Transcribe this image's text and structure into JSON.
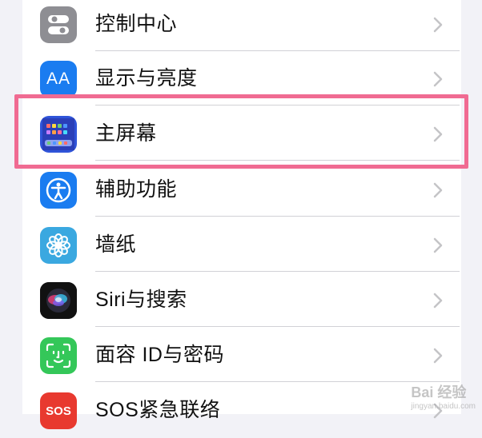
{
  "settings": {
    "items": [
      {
        "label": "控制中心",
        "icon": "control-center-icon",
        "color": "#8e8e93"
      },
      {
        "label": "显示与亮度",
        "icon": "display-brightness-icon",
        "color": "#1a7cf0",
        "icon_text": "AA"
      },
      {
        "label": "主屏幕",
        "icon": "home-screen-icon",
        "color": "#2f54d9"
      },
      {
        "label": "辅助功能",
        "icon": "accessibility-icon",
        "color": "#1a7cf0"
      },
      {
        "label": "墙纸",
        "icon": "wallpaper-icon",
        "color": "#3aa8e0"
      },
      {
        "label": "Siri与搜索",
        "icon": "siri-icon",
        "color": "#1c1c1e"
      },
      {
        "label": "面容 ID与密码",
        "icon": "face-id-icon",
        "color": "#34c759"
      },
      {
        "label": "SOS紧急联络",
        "icon": "sos-icon",
        "color": "#e8392f",
        "icon_text": "SOS"
      }
    ],
    "highlighted_index": 2,
    "highlight_color": "#f06b92"
  },
  "watermark": {
    "text": "Bai 经验",
    "sub": "jingyan.baidu.com"
  }
}
